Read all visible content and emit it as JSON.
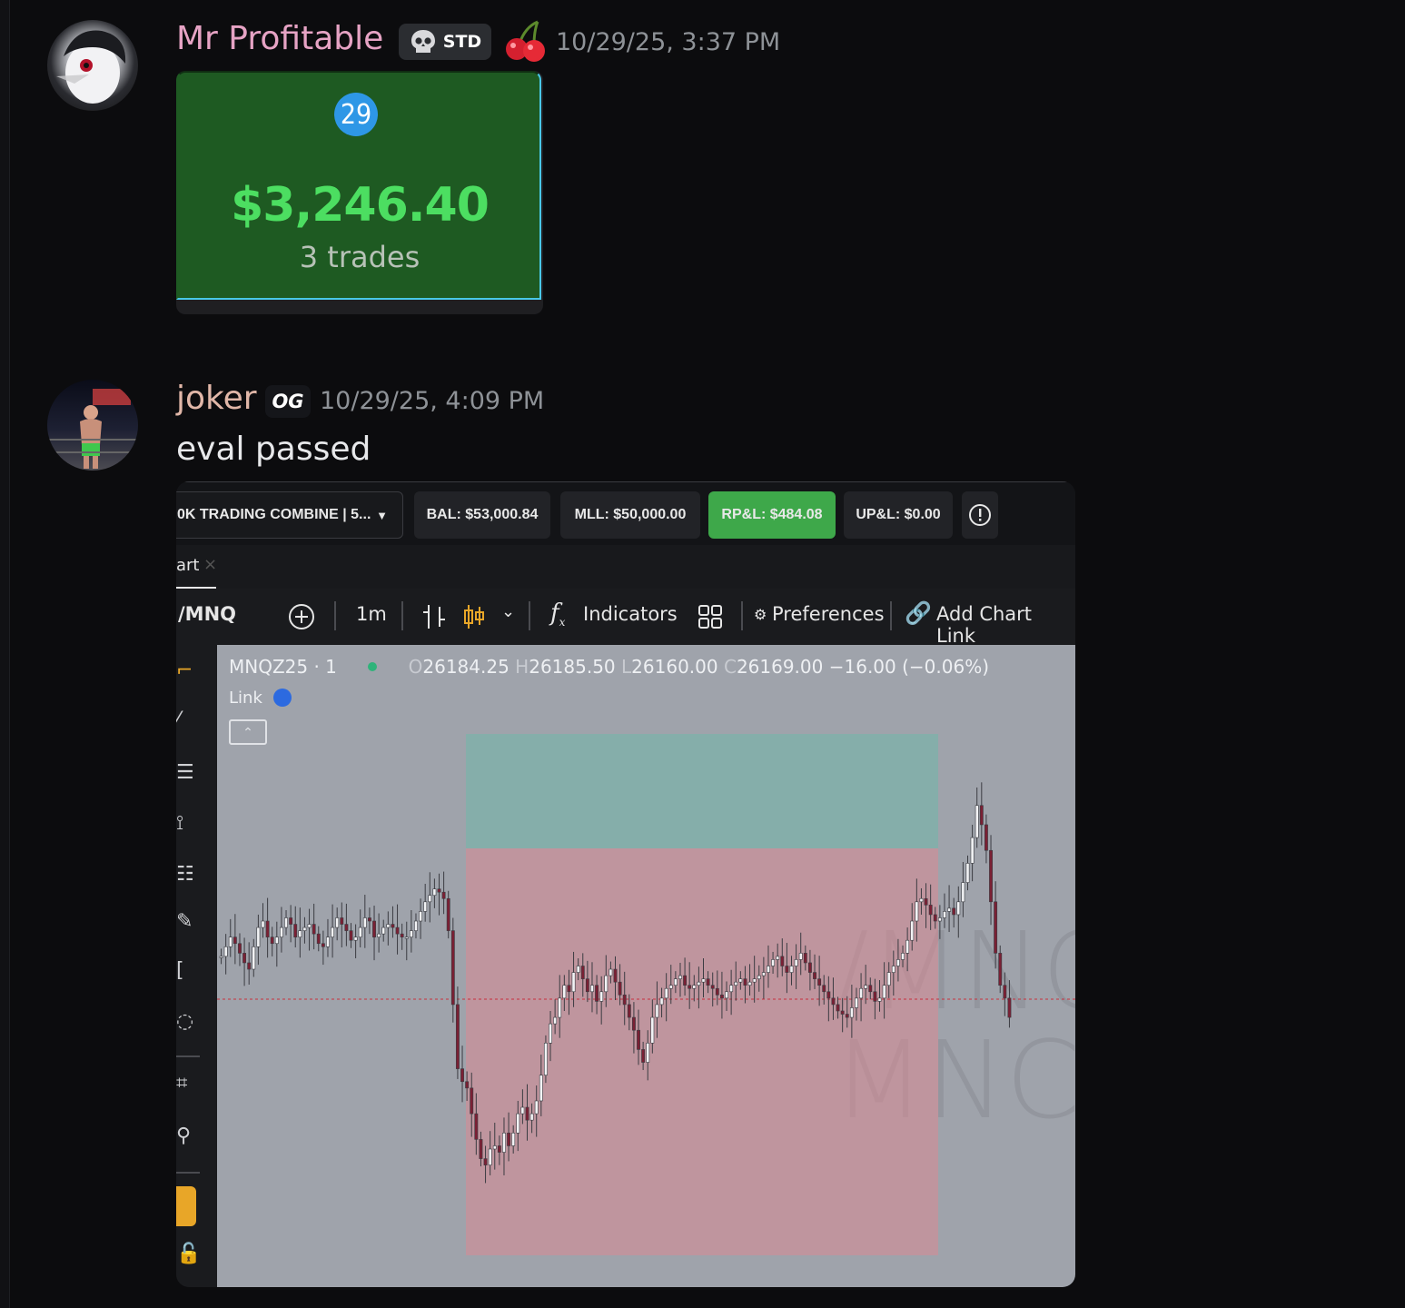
{
  "messages": [
    {
      "author": "Mr Profitable",
      "author_color": "#e6a3c4",
      "badge": "STD",
      "badge_icon": "skull-icon",
      "emoji": "cherries",
      "timestamp": "10/29/25, 3:37 PM",
      "card": {
        "day_number": "29",
        "pnl": "$3,246.40",
        "trades": "3 trades",
        "bg_color": "#1e5a22",
        "pnl_color": "#4cde61"
      }
    },
    {
      "author": "joker",
      "author_color": "#e1b7a8",
      "badge": "OG",
      "timestamp": "10/29/25, 4:09 PM",
      "text": "eval passed"
    }
  ],
  "platform": {
    "account_selector": "0K TRADING COMBINE | 5...",
    "bal": "BAL: $53,000.84",
    "mll": "MLL: $50,000.00",
    "rpnl": "RP&L: $484.08",
    "upnl": "UP&L: $0.00",
    "rpnl_color": "#3ea84a",
    "tab_label": "art",
    "tab_close": "×",
    "symbol": "/MNQ",
    "interval": "1m",
    "indicators": "Indicators",
    "preferences": "Preferences",
    "add_chart_link": "Add Chart Link",
    "legend": {
      "ticker": "MNQZ25 · 1",
      "open_label": "O",
      "open": "26184.25",
      "high_label": "H",
      "high": "26185.50",
      "low_label": "L",
      "low": "26160.00",
      "close_label": "C",
      "close": "26169.00",
      "change": "−16.00 (−0.06%)",
      "link": "Link"
    },
    "watermark_line1": "/MNC",
    "watermark_line2": "MNC"
  },
  "chart_data": {
    "type": "candlestick",
    "title": "",
    "symbol": "MNQZ25",
    "interval": "1m",
    "candles_shape_note_free": true,
    "closes": [
      0.515,
      0.53,
      0.545,
      0.535,
      0.52,
      0.505,
      0.495,
      0.53,
      0.56,
      0.57,
      0.545,
      0.535,
      0.545,
      0.56,
      0.575,
      0.565,
      0.545,
      0.555,
      0.56,
      0.565,
      0.55,
      0.535,
      0.53,
      0.545,
      0.56,
      0.575,
      0.565,
      0.555,
      0.54,
      0.545,
      0.56,
      0.575,
      0.57,
      0.545,
      0.55,
      0.56,
      0.565,
      0.56,
      0.55,
      0.545,
      0.545,
      0.555,
      0.57,
      0.585,
      0.6,
      0.61,
      0.62,
      0.615,
      0.605,
      0.555,
      0.44,
      0.34,
      0.32,
      0.31,
      0.27,
      0.23,
      0.2,
      0.19,
      0.215,
      0.22,
      0.21,
      0.24,
      0.22,
      0.24,
      0.27,
      0.28,
      0.26,
      0.27,
      0.29,
      0.33,
      0.38,
      0.41,
      0.42,
      0.45,
      0.47,
      0.46,
      0.49,
      0.5,
      0.48,
      0.46,
      0.47,
      0.445,
      0.46,
      0.485,
      0.495,
      0.475,
      0.455,
      0.44,
      0.42,
      0.4,
      0.37,
      0.35,
      0.38,
      0.42,
      0.44,
      0.45,
      0.465,
      0.47,
      0.48,
      0.485,
      0.47,
      0.465,
      0.47,
      0.475,
      0.48,
      0.47,
      0.465,
      0.455,
      0.45,
      0.46,
      0.47,
      0.475,
      0.48,
      0.47,
      0.475,
      0.48,
      0.485,
      0.49,
      0.5,
      0.51,
      0.515,
      0.5,
      0.49,
      0.5,
      0.51,
      0.52,
      0.505,
      0.49,
      0.48,
      0.47,
      0.46,
      0.45,
      0.44,
      0.43,
      0.425,
      0.42,
      0.435,
      0.45,
      0.465,
      0.47,
      0.46,
      0.445,
      0.45,
      0.47,
      0.49,
      0.5,
      0.51,
      0.52,
      0.54,
      0.57,
      0.6,
      0.605,
      0.595,
      0.58,
      0.57,
      0.575,
      0.585,
      0.59,
      0.58,
      0.6,
      0.63,
      0.66,
      0.7,
      0.75,
      0.72,
      0.68,
      0.6,
      0.52,
      0.47,
      0.45,
      0.42
    ]
  }
}
